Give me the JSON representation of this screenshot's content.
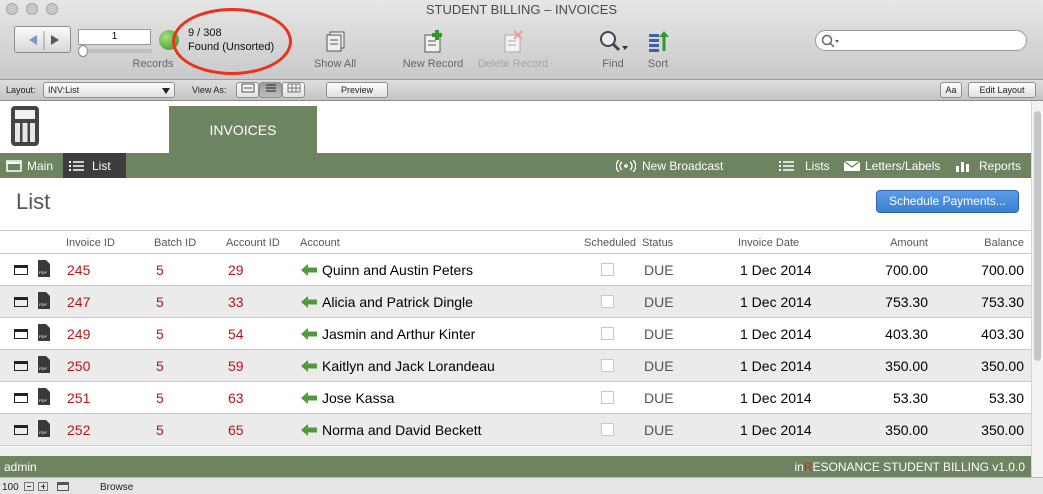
{
  "window": {
    "title": "STUDENT BILLING – INVOICES"
  },
  "toolbar": {
    "record_number": "1",
    "records_label": "Records",
    "found_count": "9 / 308",
    "found_status": "Found (Unsorted)",
    "show_all": "Show All",
    "new_record": "New Record",
    "delete_record": "Delete Record",
    "find": "Find",
    "sort": "Sort",
    "search_placeholder": ""
  },
  "layoutbar": {
    "layout_label": "Layout:",
    "layout_value": "INV:List",
    "view_as_label": "View As:",
    "preview": "Preview",
    "aa": "Aa",
    "edit_layout": "Edit Layout"
  },
  "tab": {
    "label": "INVOICES"
  },
  "nav": {
    "main": "Main",
    "list": "List",
    "broadcast": "New Broadcast",
    "lists": "Lists",
    "letters": "Letters/Labels",
    "reports": "Reports"
  },
  "page": {
    "title": "List",
    "schedule_button": "Schedule Payments..."
  },
  "table": {
    "headers": {
      "invoice_id": "Invoice ID",
      "batch_id": "Batch ID",
      "account_id": "Account ID",
      "account": "Account",
      "scheduled": "Scheduled",
      "status": "Status",
      "invoice_date": "Invoice Date",
      "amount": "Amount",
      "balance": "Balance"
    },
    "rows": [
      {
        "invoice_id": "245",
        "batch_id": "5",
        "account_id": "29",
        "account": "Quinn and Austin Peters",
        "status": "DUE",
        "invoice_date": "1 Dec 2014",
        "amount": "700.00",
        "balance": "700.00"
      },
      {
        "invoice_id": "247",
        "batch_id": "5",
        "account_id": "33",
        "account": "Alicia and Patrick Dingle",
        "status": "DUE",
        "invoice_date": "1 Dec 2014",
        "amount": "753.30",
        "balance": "753.30"
      },
      {
        "invoice_id": "249",
        "batch_id": "5",
        "account_id": "54",
        "account": "Jasmin and Arthur Kinter",
        "status": "DUE",
        "invoice_date": "1 Dec 2014",
        "amount": "403.30",
        "balance": "403.30"
      },
      {
        "invoice_id": "250",
        "batch_id": "5",
        "account_id": "59",
        "account": "Kaitlyn and Jack Lorandeau",
        "status": "DUE",
        "invoice_date": "1 Dec 2014",
        "amount": "350.00",
        "balance": "350.00"
      },
      {
        "invoice_id": "251",
        "batch_id": "5",
        "account_id": "63",
        "account": "Jose Kassa",
        "status": "DUE",
        "invoice_date": "1 Dec 2014",
        "amount": "53.30",
        "balance": "53.30"
      },
      {
        "invoice_id": "252",
        "batch_id": "5",
        "account_id": "65",
        "account": "Norma and David Beckett",
        "status": "DUE",
        "invoice_date": "1 Dec 2014",
        "amount": "350.00",
        "balance": "350.00"
      }
    ]
  },
  "footer": {
    "user": "admin",
    "brand_prefix": "in",
    "brand_r": "R",
    "brand_rest": "ESONANCE STUDENT BILLING v1.0.0"
  },
  "statusbar": {
    "zoom": "100",
    "mode": "Browse"
  },
  "colors": {
    "accent": "#6e8360",
    "red_text": "#b2171a",
    "button_blue": "#3d7fd4",
    "highlight_circle": "#e8331d"
  }
}
